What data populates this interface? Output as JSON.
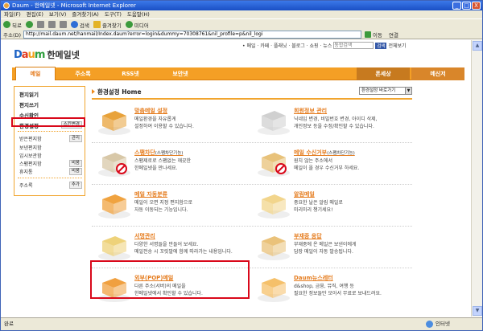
{
  "window": {
    "title": "Daum - 한메일넷 - Microsoft Internet Explorer",
    "buttons": [
      "_",
      "□",
      "X"
    ]
  },
  "menubar": [
    "파일(F)",
    "편집(E)",
    "보기(V)",
    "즐겨찾기(A)",
    "도구(T)",
    "도움말(H)"
  ],
  "toolbar": {
    "back": "뒤로",
    "search": "검색",
    "favorites": "즐겨찾기",
    "media": "미디어"
  },
  "addressbar": {
    "label": "주소(D)",
    "url": "http://mail.daum.net/hanmail/Index.daum?error=login&dummy=70308761&nil_profile=p&nil_logi",
    "go": "이동",
    "links": "연결"
  },
  "daum": {
    "toplinks": "• 메일 · 카페 · 플래닛 · 블로그 · 쇼핑 · 뉴스",
    "search_placeholder": "통합검색",
    "search_button": "검색",
    "all_services": "전체보기",
    "logo_letters": [
      "D",
      "a",
      "u",
      "m"
    ],
    "service_name": "한메일넷",
    "nav": {
      "tabs": [
        "메일",
        "주소록",
        "RSS넷",
        "보안넷"
      ],
      "right": [
        "폰세상",
        "메신저"
      ]
    }
  },
  "sidebar": {
    "compose": "편지읽기",
    "write": "편지쓰기",
    "receipt": "수신확인",
    "settings": "환경설정",
    "settings_btn": "스킨변경",
    "inbox": "받은편지함",
    "inbox_btn": "관리",
    "sent": "보낸편지함",
    "drafts": "임시보관함",
    "spam": "스팸편지함",
    "spam_btn": "비움",
    "trash": "휴지통",
    "trash_btn": "비움",
    "addressbook": "주소록",
    "addressbook_btn": "추가"
  },
  "main": {
    "title": "환경설정 Home",
    "jump_select": "환경설정 바로가기",
    "cards": [
      {
        "title": "맞춤메일 설정",
        "tag": "",
        "desc1": "메일환경을 자유롭게",
        "desc2": "설정하여 이용할 수 있습니다."
      },
      {
        "title": "회원정보 관리",
        "tag": "",
        "desc1": "닉네임 변경, 비밀번호 변경, 아이디 삭제,",
        "desc2": "개인정보 등을 수정/확인할 수 있습니다."
      },
      {
        "title": "스팸차단",
        "tag": "(스팸차단기능)",
        "desc1": "스팸제로로 스팸없는 깨끗한",
        "desc2": "한메일넷을 만나세요."
      },
      {
        "title": "메일 수신거부",
        "tag": "(스팸차단기능)",
        "desc1": "원치 않는 주소에서",
        "desc2": "메일이 올 경우 수신거부 하세요."
      },
      {
        "title": "메일 자동분류",
        "tag": "",
        "desc1": "메일이 오면 지정 편지함으로",
        "desc2": "자동 이동되는 기능입니다."
      },
      {
        "title": "알림메일",
        "tag": "",
        "desc1": "중요한 날은 알림 메일로",
        "desc2": "미리미리 챙기세요!"
      },
      {
        "title": "서명관리",
        "tag": "",
        "desc1": "다양한 서명들을 만들어 보세요.",
        "desc2": "메일전송 시 꼬릿말에 함께 따라가는 내용입니다."
      },
      {
        "title": "부재중 응답",
        "tag": "",
        "desc1": "부재중에 온 메일은 보낸이에게",
        "desc2": "답장 메일이 자동 발송됩니다."
      },
      {
        "title": "외부(POP)메일",
        "tag": "",
        "desc1": "다른 주소(서버)의 메일을",
        "desc2": "한메일넷에서 확인할 수 있습니다."
      },
      {
        "title": "Daum뉴스레터",
        "tag": "",
        "desc1": "d&shop, 금융, 뮤직, 여행 등",
        "desc2": "필요한 정보들만 모아서 무료로 보내드려요."
      }
    ]
  },
  "statusbar": {
    "left": "완료",
    "zone": "인터넷"
  }
}
